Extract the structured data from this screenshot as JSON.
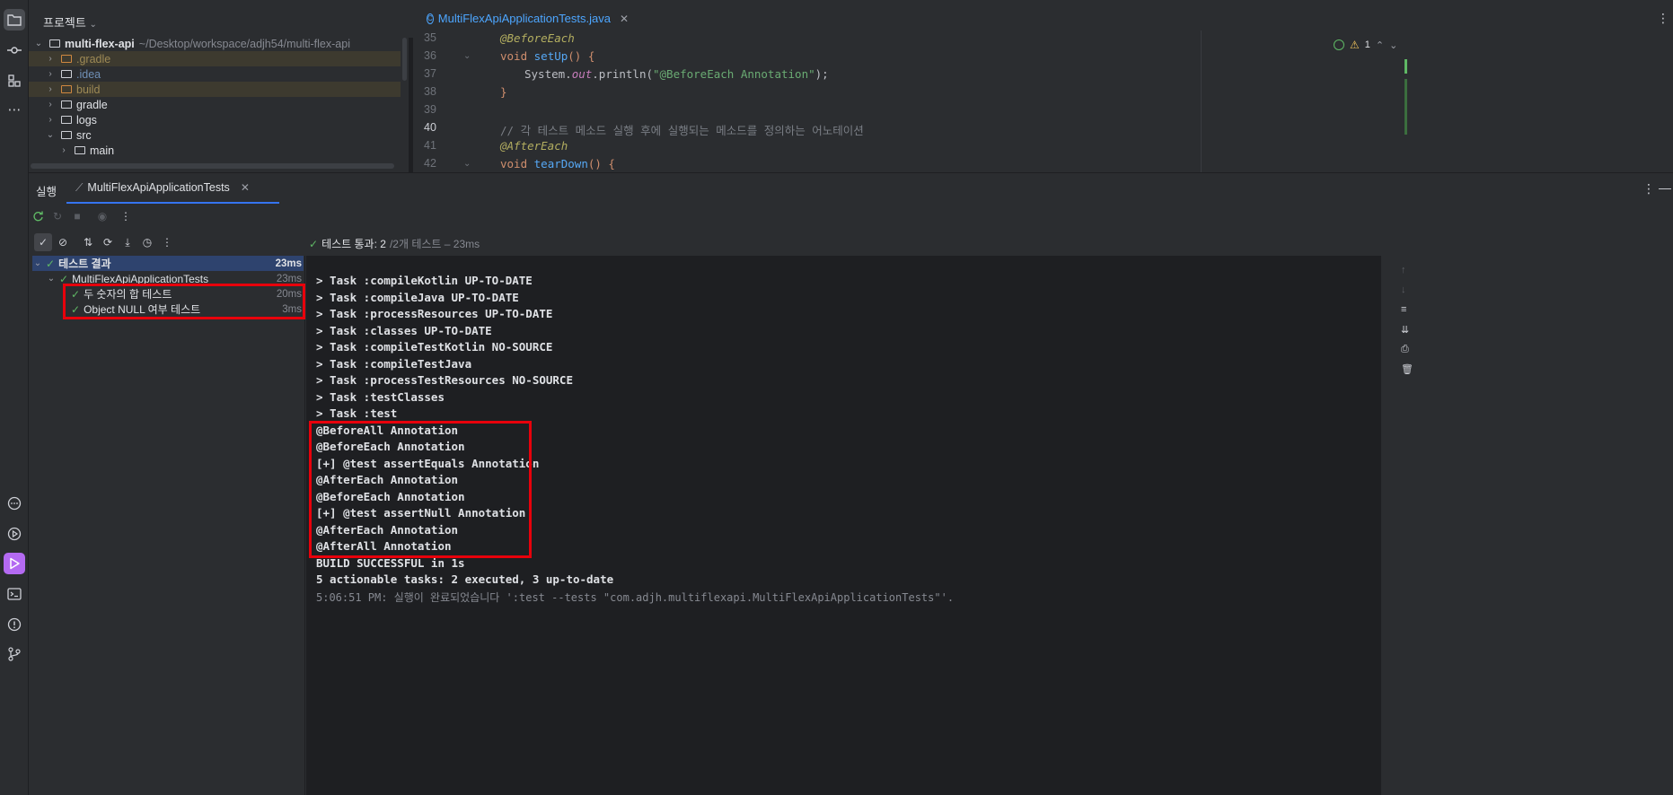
{
  "project": {
    "title": "프로젝트",
    "root_name": "multi-flex-api",
    "root_path": "~/Desktop/workspace/adjh54/multi-flex-api",
    "items": [
      {
        "label": ".gradle"
      },
      {
        "label": ".idea"
      },
      {
        "label": "build"
      },
      {
        "label": "gradle"
      },
      {
        "label": "logs"
      },
      {
        "label": "src"
      },
      {
        "label": "main"
      }
    ]
  },
  "editor": {
    "tab_label": "MultiFlexApiApplicationTests.java",
    "line_numbers": [
      "35",
      "36",
      "37",
      "38",
      "39",
      "40",
      "41",
      "42"
    ],
    "code": {
      "l35": "@BeforeEach",
      "l36_kw": "void",
      "l36_fn": "setUp",
      "l36_rest": "() {",
      "l37_a": "System.",
      "l37_out": "out",
      "l37_b": ".println(",
      "l37_str": "\"@BeforeEach Annotation\"",
      "l37_c": ");",
      "l38": "}",
      "l40": "// 각 테스트 메소드 실행 후에 실행되는 메소드를 정의하는 어노테이션",
      "l41": "@AfterEach",
      "l42_kw": "void",
      "l42_fn": "tearDown",
      "l42_rest": "() {"
    },
    "warning_count": "1"
  },
  "run": {
    "tab_run": "실행",
    "tab_config": "MultiFlexApiApplicationTests",
    "status_passed": "테스트 통과: 2",
    "status_detail": "/2개 테스트 – 23ms",
    "tree": [
      {
        "label": "테스트 결과",
        "duration": "23ms"
      },
      {
        "label": "MultiFlexApiApplicationTests",
        "duration": "23ms"
      },
      {
        "label": "두 숫자의 합 테스트",
        "duration": "20ms"
      },
      {
        "label": "Object NULL 여부 테스트",
        "duration": "3ms"
      }
    ],
    "console": [
      "> Task :compileKotlin UP-TO-DATE",
      "> Task :compileJava UP-TO-DATE",
      "> Task :processResources UP-TO-DATE",
      "> Task :classes UP-TO-DATE",
      "> Task :compileTestKotlin NO-SOURCE",
      "> Task :compileTestJava",
      "> Task :processTestResources NO-SOURCE",
      "> Task :testClasses",
      "> Task :test",
      "@BeforeAll Annotation",
      "@BeforeEach Annotation",
      "[+] @test assertEquals Annotation",
      "@AfterEach Annotation",
      "@BeforeEach Annotation",
      "[+] @test assertNull Annotation",
      "@AfterEach Annotation",
      "@AfterAll Annotation",
      "BUILD SUCCESSFUL in 1s",
      "5 actionable tasks: 2 executed, 3 up-to-date",
      "5:06:51 PM: 실행이 완료되었습니다 ':test --tests \"com.adjh.multiflexapi.MultiFlexApiApplicationTests\"'."
    ]
  },
  "colors": {
    "accent": "#3574f0",
    "run_active": "#b46af2",
    "success": "#5fb865",
    "highlight_box": "#e8000b"
  }
}
